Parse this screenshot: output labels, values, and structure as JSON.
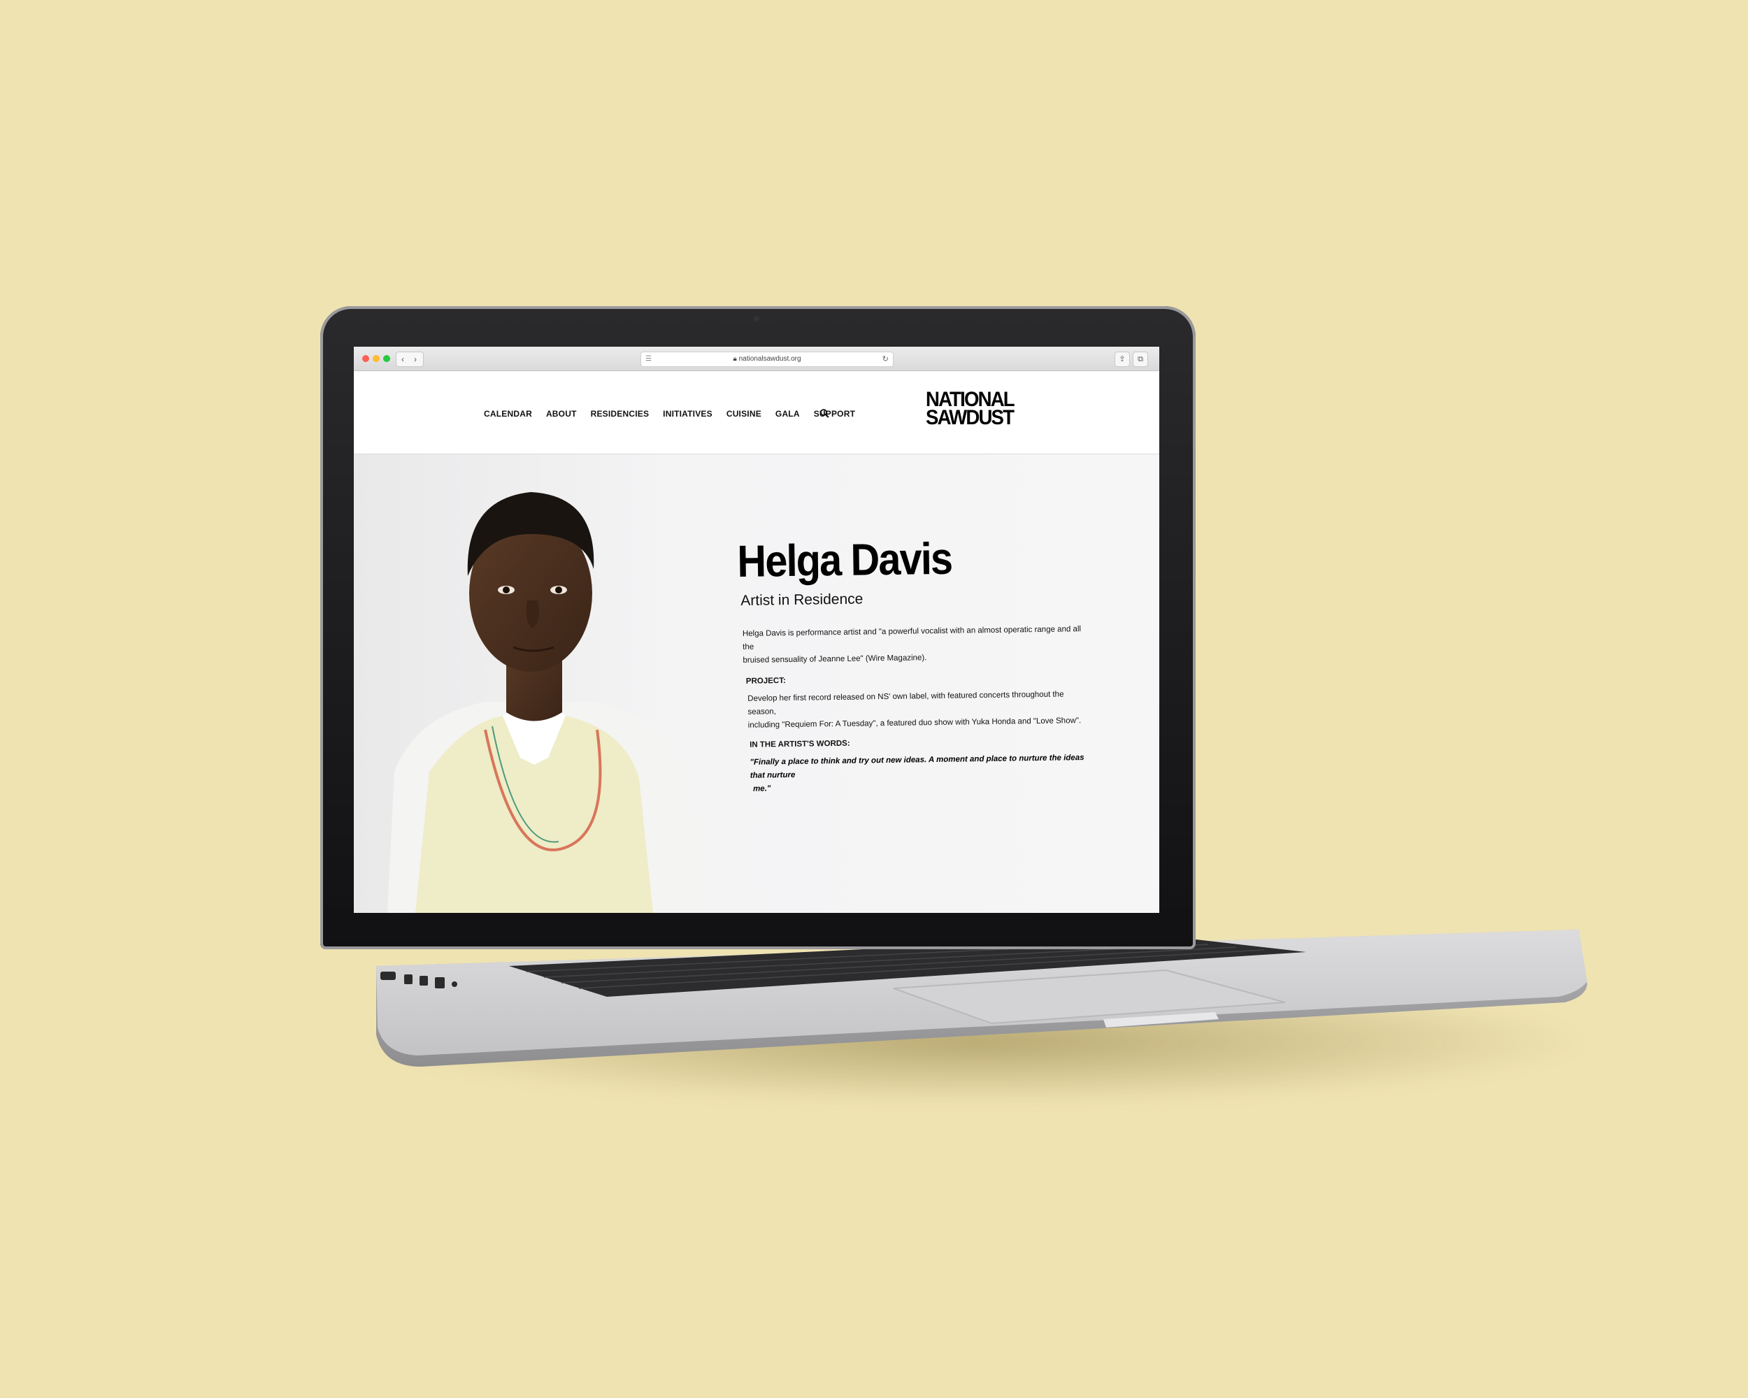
{
  "browser": {
    "url": "nationalsawdust.org",
    "back_glyph": "‹",
    "forward_glyph": "›"
  },
  "nav": {
    "items": [
      "CALENDAR",
      "ABOUT",
      "RESIDENCIES",
      "INITIATIVES",
      "CUISINE",
      "GALA",
      "SUPPORT"
    ]
  },
  "logo": {
    "line1": "NATIONAL",
    "line2": "SAWDUST"
  },
  "artist": {
    "name": "Helga Davis",
    "role": "Artist in Residence",
    "bio_line1": "Helga Davis is performance artist and \"a powerful vocalist with an almost operatic range and all the",
    "bio_line2": "bruised sensuality of Jeanne Lee\" (Wire Magazine).",
    "project_label": "PROJECT:",
    "project_line1": "Develop her first record released on NS' own label,   with featured concerts throughout the season,",
    "project_line2": "including \"Requiem For: A Tuesday\", a featured duo show with Yuka Honda and \"Love Show\".",
    "words_label": "IN THE ARTIST'S WORDS:",
    "quote_line1": "\"Finally a place to think and try out new ideas. A moment and place to nurture the ideas that nurture",
    "quote_line2": "me.\""
  },
  "colors": {
    "background": "#efe3b2",
    "laptop_body": "#c9c9cb",
    "bezel": "#111113",
    "text": "#111111"
  }
}
